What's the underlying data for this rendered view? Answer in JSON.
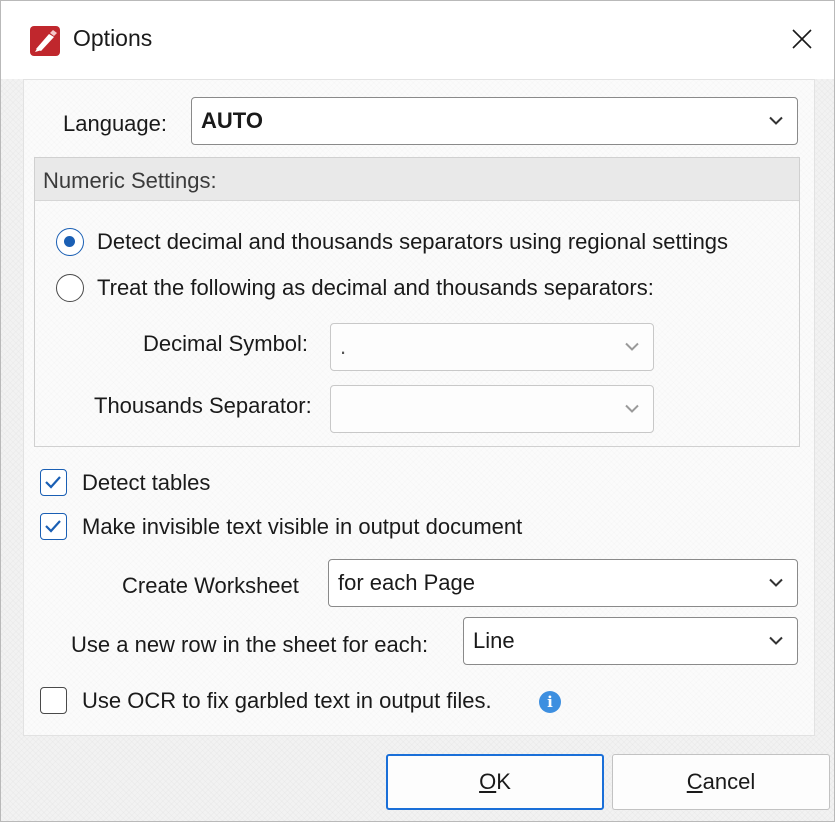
{
  "window": {
    "title": "Options"
  },
  "language": {
    "label": "Language:",
    "value": "AUTO"
  },
  "numeric": {
    "title": "Numeric Settings:",
    "options": [
      {
        "label": "Detect decimal and thousands separators using regional settings",
        "checked": true
      },
      {
        "label": "Treat the following as decimal and thousands separators:",
        "checked": false
      }
    ],
    "decimal_label": "Decimal Symbol:",
    "decimal_value": ".",
    "thousands_label": "Thousands Separator:",
    "thousands_value": ""
  },
  "checks": {
    "detect_tables": {
      "label": "Detect tables",
      "checked": true
    },
    "invisible_text": {
      "label": "Make invisible text visible in output document",
      "checked": true
    },
    "ocr": {
      "label": "Use OCR to fix garbled text in output files.",
      "checked": false
    }
  },
  "worksheet": {
    "label": "Create Worksheet",
    "value": "for each Page"
  },
  "newrow": {
    "label": "Use a new row in the sheet for each:",
    "value": "Line"
  },
  "buttons": {
    "ok_mnemonic": "O",
    "ok_rest": "K",
    "cancel_mnemonic": "C",
    "cancel_rest": "ancel"
  },
  "colors": {
    "accent": "#1a5fb4",
    "info": "#3d8fe0",
    "app_icon": "#c0272d"
  },
  "icons": {
    "app": "pdf-editor-logo-icon",
    "close": "close-icon",
    "info": "info-icon",
    "chevron": "chevron-down-icon",
    "check": "checkmark-icon"
  }
}
